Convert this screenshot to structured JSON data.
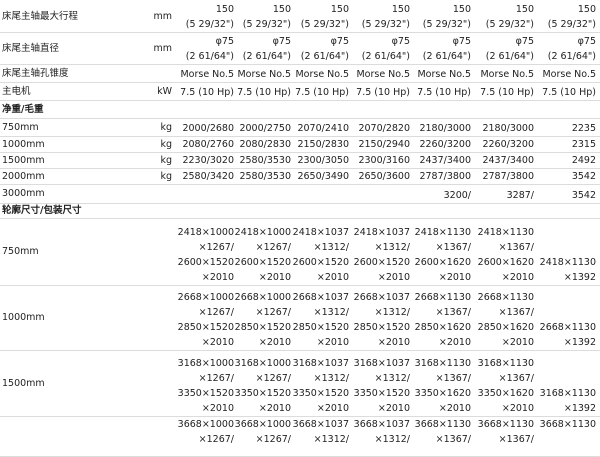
{
  "rows": [
    {
      "label": "床尾主轴最大行程",
      "unit": "mm",
      "values": [
        [
          "150",
          "(5 29/32\")"
        ],
        [
          "150",
          "(5 29/32\")"
        ],
        [
          "150",
          "(5 29/32\")"
        ],
        [
          "150",
          "(5 29/32\")"
        ],
        [
          "150",
          "(5 29/32\")"
        ],
        [
          "150",
          "(5 29/32\")"
        ],
        [
          "150",
          "(5 29/32\")"
        ]
      ]
    },
    {
      "label": "床尾主轴直径",
      "unit": "mm",
      "values": [
        [
          "φ75",
          "(2 61/64\")"
        ],
        [
          "φ75",
          "(2 61/64\")"
        ],
        [
          "φ75",
          "(2 61/64\")"
        ],
        [
          "φ75",
          "(2 61/64\")"
        ],
        [
          "φ75",
          "(2 61/64\")"
        ],
        [
          "φ75",
          "(2 61/64\")"
        ],
        [
          "φ75",
          "(2 61/64\")"
        ]
      ]
    },
    {
      "label": "床尾主轴孔锥度",
      "unit": "",
      "values": [
        [
          "Morse No.5"
        ],
        [
          "Morse No.5"
        ],
        [
          "Morse No.5"
        ],
        [
          "Morse No.5"
        ],
        [
          "Morse No.5"
        ],
        [
          "Morse No.5"
        ],
        [
          "Morse No.5"
        ]
      ]
    },
    {
      "label": "主电机",
      "unit": "kW",
      "values": [
        [
          "7.5 (10 Hp)"
        ],
        [
          "7.5 (10 Hp)"
        ],
        [
          "7.5 (10 Hp)"
        ],
        [
          "7.5 (10 Hp)"
        ],
        [
          "7.5 (10 Hp)"
        ],
        [
          "7.5 (10 Hp)"
        ],
        [
          "7.5 (10 Hp)"
        ]
      ]
    },
    {
      "label": "净重/毛重",
      "unit": "",
      "values": []
    },
    {
      "label": "750mm",
      "unit": "kg",
      "values": [
        [
          "2000/2680"
        ],
        [
          "2000/2750"
        ],
        [
          "2070/2410"
        ],
        [
          "2070/2820"
        ],
        [
          "2180/3000"
        ],
        [
          "2180/3000"
        ],
        [
          "2235"
        ]
      ]
    },
    {
      "label": "1000mm",
      "unit": "kg",
      "values": [
        [
          "2080/2760"
        ],
        [
          "2080/2830"
        ],
        [
          "2150/2830"
        ],
        [
          "2150/2940"
        ],
        [
          "2260/3200"
        ],
        [
          "2260/3200"
        ],
        [
          "2315"
        ]
      ]
    },
    {
      "label": "1500mm",
      "unit": "kg",
      "values": [
        [
          "2230/3020"
        ],
        [
          "2580/3530"
        ],
        [
          "2300/3050"
        ],
        [
          "2300/3160"
        ],
        [
          "2437/3400"
        ],
        [
          "2437/3400"
        ],
        [
          "2492"
        ]
      ]
    },
    {
      "label": "2000mm",
      "unit": "kg",
      "values": [
        [
          "2580/3420"
        ],
        [
          "2580/3530"
        ],
        [
          "2650/3490"
        ],
        [
          "2650/3600"
        ],
        [
          "2787/3800"
        ],
        [
          "2787/3800"
        ],
        [
          "3542"
        ]
      ]
    },
    {
      "label": "3000mm",
      "unit": "",
      "values": [
        [
          ""
        ],
        [
          ""
        ],
        [
          ""
        ],
        [
          ""
        ],
        [
          "3200/"
        ],
        [
          "3287/"
        ],
        [
          "3542"
        ]
      ]
    },
    {
      "label": "轮廓尺寸/包装尺寸",
      "unit": "",
      "values": []
    },
    {
      "label": "750mm",
      "unit": "",
      "values": [
        [
          "2418×1000",
          "×1267/",
          "2600×1520",
          "×2010"
        ],
        [
          "2418×1000",
          "×1267/",
          "2600×1520",
          "×2010"
        ],
        [
          "2418×1037",
          "×1312/",
          "2600×1520",
          "×2010"
        ],
        [
          "2418×1037",
          "×1312/",
          "2600×1520",
          "×2010"
        ],
        [
          "2418×1130",
          "×1367/",
          "2600×1620",
          "×2010"
        ],
        [
          "2418×1130",
          "×1367/",
          "2600×1620",
          "×2010"
        ],
        [
          "2418×1130",
          "×1392"
        ]
      ]
    },
    {
      "label": "1000mm",
      "unit": "",
      "values": [
        [
          "2668×1000",
          "×1267/",
          "2850×1520",
          "×2010"
        ],
        [
          "2668×1000",
          "×1267/",
          "2850×1520",
          "×2010"
        ],
        [
          "2668×1037",
          "×1312/",
          "2850×1520",
          "×2010"
        ],
        [
          "2668×1037",
          "×1312/",
          "2850×1520",
          "×2010"
        ],
        [
          "2668×1130",
          "×1367/",
          "2850×1620",
          "×2010"
        ],
        [
          "2668×1130",
          "×1367/",
          "2850×1620",
          "×2010"
        ],
        [
          "2668×1130",
          "×1392"
        ]
      ]
    },
    {
      "label": "1500mm",
      "unit": "",
      "values": [
        [
          "3168×1000",
          "×1267/",
          "3350×1520",
          "×2010"
        ],
        [
          "3168×1000",
          "×1267/",
          "3350×1520",
          "×2010"
        ],
        [
          "3168×1037",
          "×1312/",
          "3350×1520",
          "×2010"
        ],
        [
          "3168×1037",
          "×1312/",
          "3350×1520",
          "×2010"
        ],
        [
          "3168×1130",
          "×1367/",
          "3350×1620",
          "×2010"
        ],
        [
          "3168×1130",
          "×1367/",
          "3350×1620",
          "×2010"
        ],
        [
          "3168×1130",
          "×1392"
        ]
      ]
    },
    {
      "label": "",
      "unit": "",
      "values": [
        [
          "3668×1000",
          "×1267/"
        ],
        [
          "3668×1000",
          "×1267/"
        ],
        [
          "3668×1037",
          "×1312/"
        ],
        [
          "3668×1037",
          "×1312/"
        ],
        [
          "3668×1130",
          "×1367/"
        ],
        [
          "3668×1130",
          "×1367/"
        ],
        [
          "3668×1130"
        ]
      ]
    }
  ]
}
